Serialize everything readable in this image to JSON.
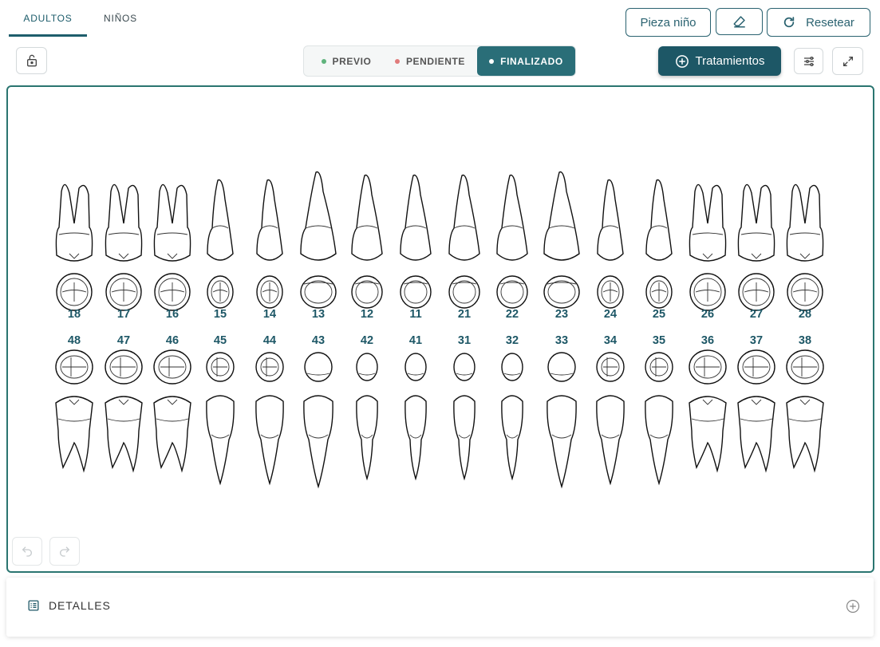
{
  "tabs": [
    {
      "label": "ADULTOS",
      "active": true
    },
    {
      "label": "NIÑOS",
      "active": false
    }
  ],
  "toolbar": {
    "pieza_nino_label": "Pieza niño",
    "eraser_icon": "eraser-icon",
    "reset_label": "Resetear",
    "reset_icon": "refresh-icon",
    "tratamientos_label": "Tratamientos",
    "tratamientos_icon": "plus-circle-icon",
    "lock_icon": "lock-icon",
    "filter_icon": "sliders-icon",
    "expand_icon": "expand-icon"
  },
  "status": [
    {
      "label": "PREVIO",
      "color": "#5fb37c",
      "active": false
    },
    {
      "label": "PENDIENTE",
      "color": "#e07b7b",
      "active": false
    },
    {
      "label": "FINALIZADO",
      "color": "#ffffff",
      "active": true
    }
  ],
  "colors": {
    "accent": "#1d5766",
    "border": "#2a7570"
  },
  "upper_teeth": [
    "18",
    "17",
    "16",
    "15",
    "14",
    "13",
    "12",
    "11",
    "21",
    "22",
    "23",
    "24",
    "25",
    "26",
    "27",
    "28"
  ],
  "lower_teeth": [
    "48",
    "47",
    "46",
    "45",
    "44",
    "43",
    "42",
    "41",
    "31",
    "32",
    "33",
    "34",
    "35",
    "36",
    "37",
    "38"
  ],
  "history": {
    "undo_icon": "undo-icon",
    "redo_icon": "redo-icon"
  },
  "details": {
    "label": "DETALLES",
    "icon": "list-icon",
    "add_icon": "plus-circle-icon"
  }
}
